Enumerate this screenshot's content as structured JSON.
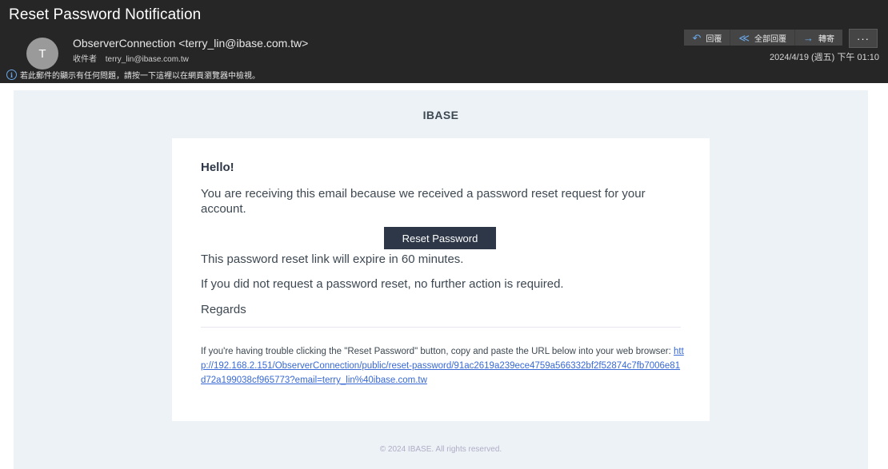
{
  "header": {
    "subject": "Reset Password Notification",
    "avatar_initial": "T",
    "sender": "ObserverConnection <terry_lin@ibase.com.tw>",
    "recipient_label": "收件者",
    "recipient": "terry_lin@ibase.com.tw",
    "info_notice": "若此郵件的顯示有任何問題，請按一下這裡以在網頁瀏覽器中檢視。",
    "date": "2024/4/19 (週五) 下午 01:10",
    "actions": [
      {
        "label": "回覆",
        "icon": "reply-icon",
        "glyph": "↶"
      },
      {
        "label": "全部回覆",
        "icon": "reply-all-icon",
        "glyph": "≪"
      },
      {
        "label": "轉寄",
        "icon": "forward-icon",
        "glyph": "→"
      }
    ],
    "more_label": "···"
  },
  "email": {
    "brand": "IBASE",
    "greeting": "Hello!",
    "intro": "You are receiving this email because we received a password reset request for your account.",
    "button_label": "Reset Password",
    "expire_note": "This password reset link will expire in 60 minutes.",
    "no_action_note": "If you did not request a password reset, no further action is required.",
    "regards": "Regards",
    "subcopy_text": "If you're having trouble clicking the \"Reset Password\" button, copy and paste the URL below into your web browser: ",
    "reset_url": "http://192.168.2.151/ObserverConnection/public/reset-password/91ac2619a239ece4759a566332bf2f52874c7fb7006e81d72a199038cf965773?email=terry_lin%40ibase.com.tw",
    "footer": "© 2024 IBASE. All rights reserved."
  },
  "colors": {
    "header_bg": "#262626",
    "accent_blue": "#6aa8e8",
    "mail_bg": "#edf2f7",
    "button_bg": "#2d3748",
    "link": "#3869d4"
  }
}
